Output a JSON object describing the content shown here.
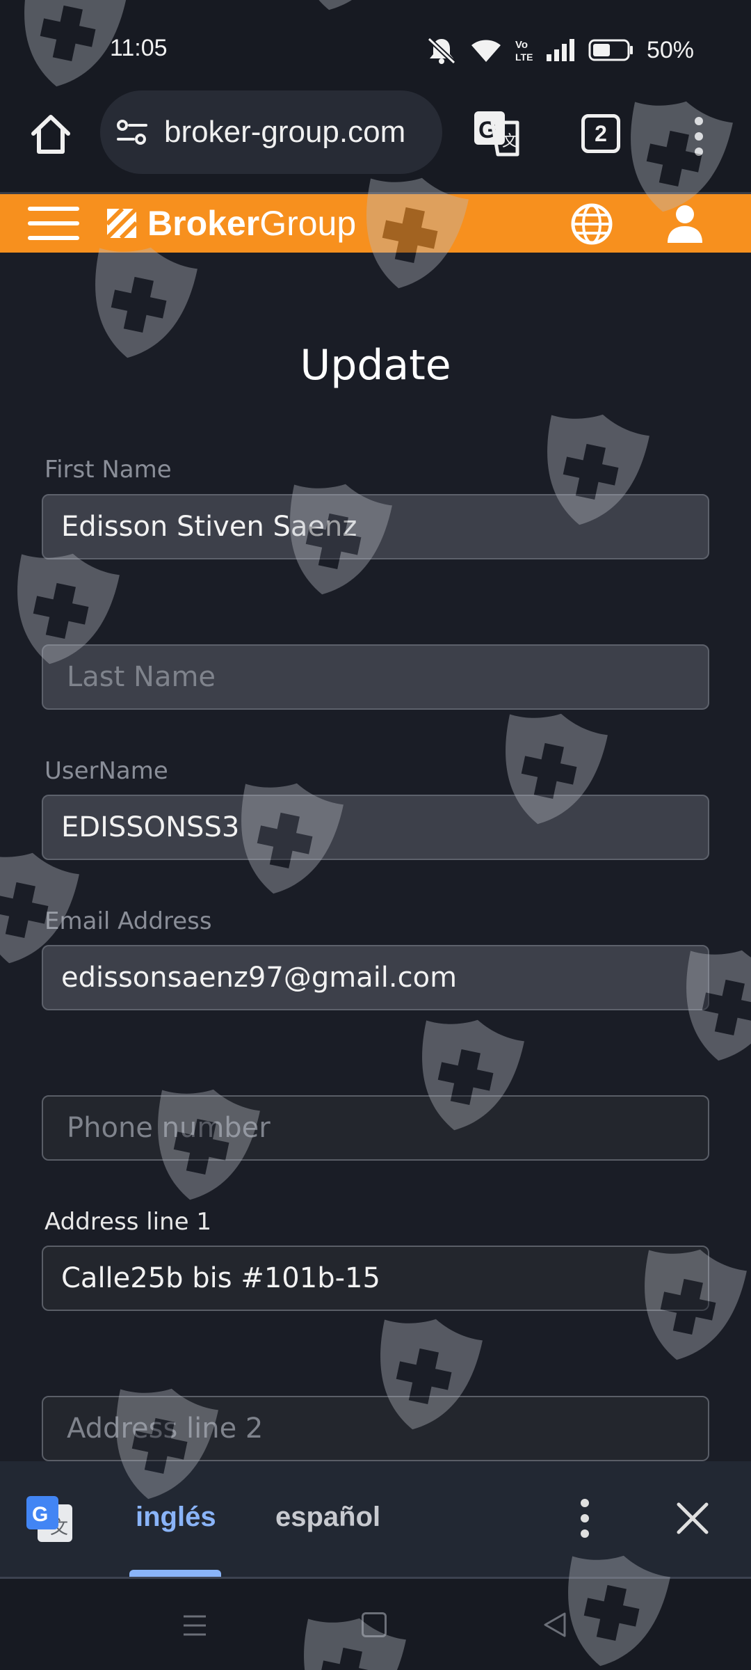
{
  "status_bar": {
    "time": "11:05",
    "battery": "50%",
    "icons": [
      "mute-icon",
      "wifi-icon",
      "volte-icon",
      "signal-icon",
      "battery-icon"
    ]
  },
  "browser": {
    "url": "broker-group.com",
    "tab_count": "2"
  },
  "site_header": {
    "logo_bold": "Broker",
    "logo_light": "Group",
    "accent_color": "#f7901e"
  },
  "form": {
    "title": "Update",
    "first_name": {
      "label": "First Name",
      "value": "Edisson Stiven Saenz"
    },
    "last_name": {
      "label": "",
      "placeholder": "Last Name",
      "value": ""
    },
    "username": {
      "label": "UserName",
      "value": "EDISSONSS3"
    },
    "email": {
      "label": "Email Address",
      "value": "edissonsaenz97@gmail.com"
    },
    "phone": {
      "label": "",
      "placeholder": "Phone number",
      "value": ""
    },
    "address1": {
      "label": "Address line 1",
      "value": "Calle25b bis #101b-15"
    },
    "address2": {
      "label": "",
      "placeholder": "Address line 2",
      "value": ""
    }
  },
  "translate_bar": {
    "source_language": "inglés",
    "target_language": "español",
    "active_color": "#8ab4f8"
  }
}
